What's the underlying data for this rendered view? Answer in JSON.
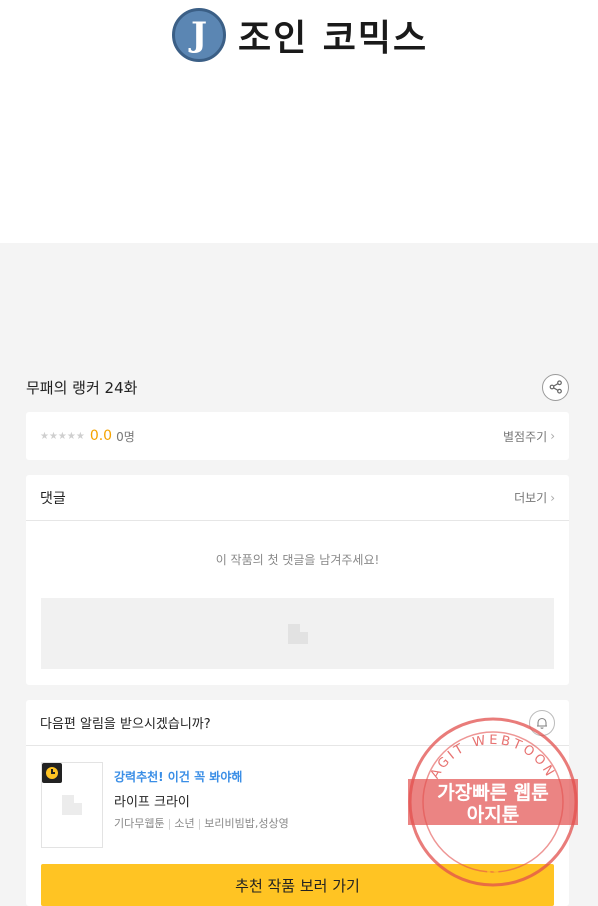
{
  "site": {
    "logo_letter": "J",
    "logo_text": "조인 코믹스"
  },
  "episode": {
    "title": "무패의 랭커 24화"
  },
  "rating": {
    "stars": "★★★★★",
    "score": "0.0",
    "count": "0명",
    "rate_label": "별점주기"
  },
  "comments": {
    "heading": "댓글",
    "more_label": "더보기",
    "empty_message": "이 작품의 첫 댓글을 남겨주세요!"
  },
  "notify": {
    "question": "다음편 알림을 받으시겠습니까?",
    "recommend": {
      "tag": "강력추천! 이건 꼭 봐야해",
      "title": "라이프 크라이",
      "meta": [
        "기다무웹툰",
        "소년",
        "보리비빔밥,성상영"
      ]
    },
    "cta_label": "추천 작품 보러 가기"
  },
  "watermark": {
    "arc_text": "AGIT WEBTOON",
    "line1": "가장빠른 웹툰",
    "line2": "아지툰"
  },
  "colors": {
    "accent_yellow": "#ffc423",
    "score_orange": "#f5a300",
    "tag_blue": "#3a8ee6",
    "stamp_red": "#e2504e"
  }
}
